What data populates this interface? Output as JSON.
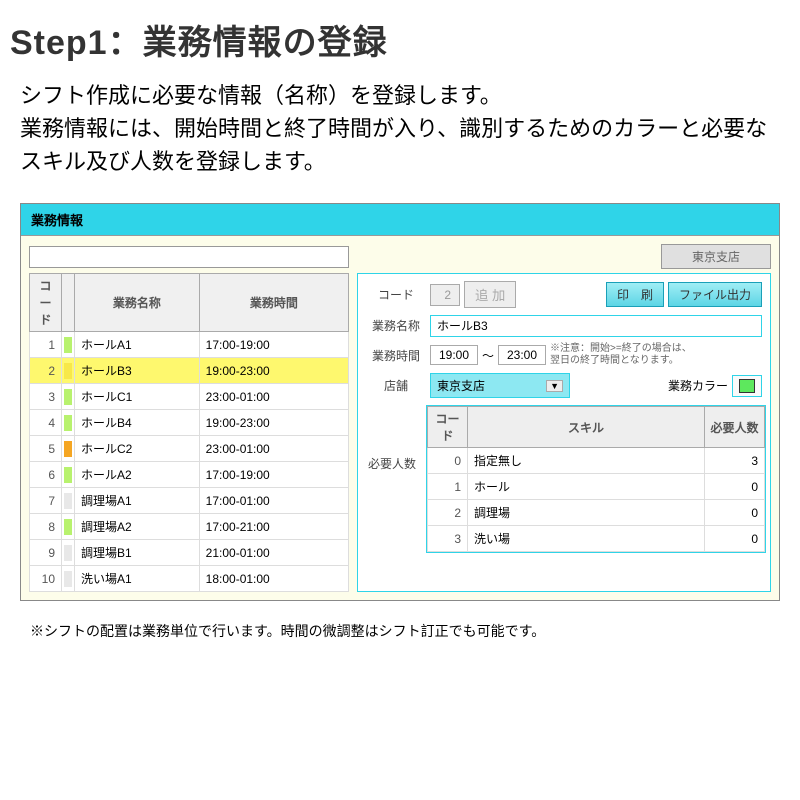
{
  "title_prefix": "Step1：",
  "title_main": "業務情報の登録",
  "description_line1": "シフト作成に必要な情報（名称）を登録します。",
  "description_line2": "業務情報には、開始時間と終了時間が入り、識別するためのカラーと必要なスキル及び人数を登録します。",
  "window": {
    "title": "業務情報",
    "store_top": "東京支店"
  },
  "left_table": {
    "headers": {
      "code": "コード",
      "name": "業務名称",
      "time": "業務時間"
    },
    "rows": [
      {
        "code": "1",
        "color": "#b8f26e",
        "name": "ホールA1",
        "time": "17:00-19:00"
      },
      {
        "code": "2",
        "color": "#f7e84a",
        "name": "ホールB3",
        "time": "19:00-23:00",
        "selected": true
      },
      {
        "code": "3",
        "color": "#b8f26e",
        "name": "ホールC1",
        "time": "23:00-01:00"
      },
      {
        "code": "4",
        "color": "#b8f26e",
        "name": "ホールB4",
        "time": "19:00-23:00"
      },
      {
        "code": "5",
        "color": "#f5a623",
        "name": "ホールC2",
        "time": "23:00-01:00"
      },
      {
        "code": "6",
        "color": "#b8f26e",
        "name": "ホールA2",
        "time": "17:00-19:00"
      },
      {
        "code": "7",
        "color": "#e8e8e8",
        "name": "調理場A1",
        "time": "17:00-01:00"
      },
      {
        "code": "8",
        "color": "#b8f26e",
        "name": "調理場A2",
        "time": "17:00-21:00"
      },
      {
        "code": "9",
        "color": "#e8e8e8",
        "name": "調理場B1",
        "time": "21:00-01:00"
      },
      {
        "code": "10",
        "color": "#e8e8e8",
        "name": "洗い場A1",
        "time": "18:00-01:00"
      }
    ]
  },
  "form": {
    "labels": {
      "code": "コード",
      "name": "業務名称",
      "time": "業務時間",
      "store": "店舗",
      "color": "業務カラー",
      "count": "必要人数"
    },
    "code_value": "2",
    "btn_add": "追 加",
    "btn_print": "印　刷",
    "btn_file": "ファイル出力",
    "name_value": "ホールB3",
    "time_start": "19:00",
    "time_sep": "～",
    "time_end": "23:00",
    "time_note1": "※注意：開始>=終了の場合は、",
    "time_note2": "翌日の終了時間となります。",
    "store_value": "東京支店"
  },
  "skill_table": {
    "headers": {
      "code": "コード",
      "skill": "スキル",
      "count": "必要人数"
    },
    "rows": [
      {
        "code": "0",
        "skill": "指定無し",
        "count": "3"
      },
      {
        "code": "1",
        "skill": "ホール",
        "count": "0"
      },
      {
        "code": "2",
        "skill": "調理場",
        "count": "0"
      },
      {
        "code": "3",
        "skill": "洗い場",
        "count": "0"
      }
    ]
  },
  "footer_note": "※シフトの配置は業務単位で行います。時間の微調整はシフト訂正でも可能です。"
}
